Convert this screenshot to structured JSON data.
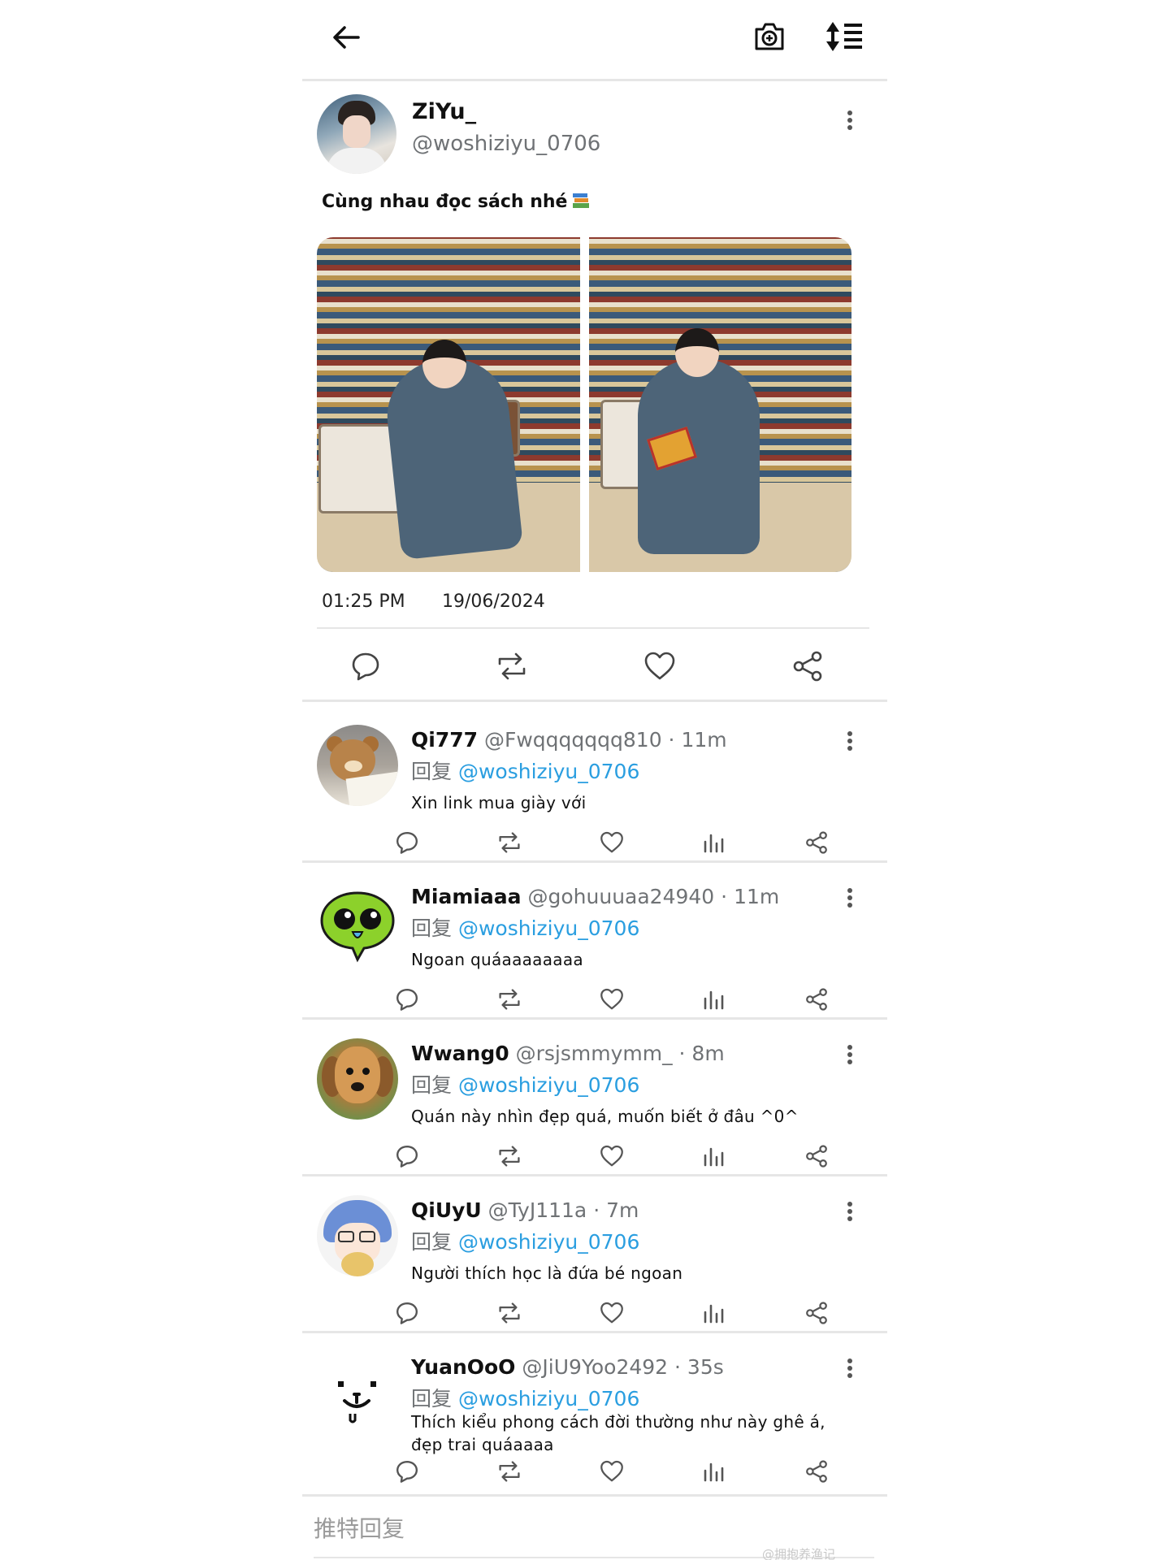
{
  "colors": {
    "accent": "#2a9ee0",
    "text": "#111111",
    "muted": "#6f7275",
    "divider": "#e6e6e6"
  },
  "toolbar": {
    "back_icon": "arrow-left-icon",
    "camera_icon": "camera-plus-icon",
    "sort_icon": "sort-list-icon"
  },
  "post": {
    "display_name": "ZiYu_",
    "handle": "@woshiziyu_0706",
    "text": "Cùng nhau đọc sách nhé",
    "time": "01:25 PM",
    "date": "19/06/2024",
    "media_count": 2,
    "actions": [
      "reply-icon",
      "retweet-icon",
      "like-icon",
      "share-icon"
    ]
  },
  "replies": [
    {
      "name": "Qi777",
      "handle": "@Fwqqqqqqq810",
      "age": "11m",
      "prefix": "回复",
      "mention": "@woshiziyu_0706",
      "text": "Xin link mua giày với"
    },
    {
      "name": "Miamiaaa",
      "handle": "@gohuuuaa24940",
      "age": "11m",
      "prefix": "回复",
      "mention": "@woshiziyu_0706",
      "text": "Ngoan quáaaaaaaaa"
    },
    {
      "name": "Wwang0",
      "handle": "@rsjsmmymm_",
      "age": "8m",
      "prefix": "回复",
      "mention": "@woshiziyu_0706",
      "text": "Quán này nhìn đẹp quá, muốn biết ở đâu ^0^"
    },
    {
      "name": "QiUyU",
      "handle": "@TyJ111a",
      "age": "7m",
      "prefix": "回复",
      "mention": "@woshiziyu_0706",
      "text": "Người thích học là đứa bé ngoan"
    },
    {
      "name": "YuanOoO",
      "handle": "@JiU9Yoo2492",
      "age": "35s",
      "prefix": "回复",
      "mention": "@woshiziyu_0706",
      "text": "Thích kiểu phong cách đời thường như này ghê á, đẹp trai quáaaaa"
    }
  ],
  "reply_bar": {
    "placeholder": "推特回复"
  },
  "watermark": "@拥抱养渔记"
}
